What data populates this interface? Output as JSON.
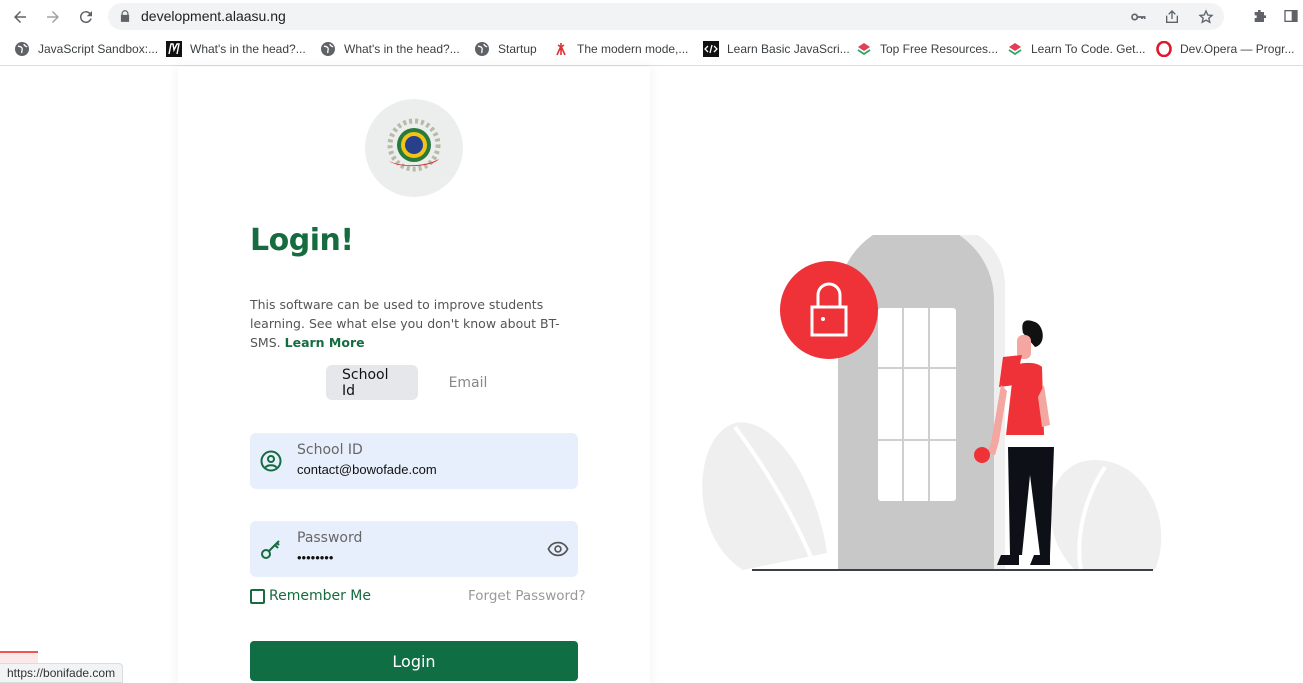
{
  "browser": {
    "url": "development.alaasu.ng",
    "status_url": "https://bonifade.com",
    "bookmarks": [
      {
        "label": "JavaScript Sandbox:...",
        "icon": "globe-icon"
      },
      {
        "label": "What's in the head?...",
        "icon": "m-logo-icon"
      },
      {
        "label": "What's in the head?...",
        "icon": "globe-icon"
      },
      {
        "label": "Startup",
        "icon": "globe-icon"
      },
      {
        "label": "The modern mode,...",
        "icon": "tower-icon"
      },
      {
        "label": "Learn Basic JavaScri...",
        "icon": "code-icon"
      },
      {
        "label": "Top Free Resources...",
        "icon": "layers-icon"
      },
      {
        "label": "Learn To Code. Get...",
        "icon": "layers-icon"
      },
      {
        "label": "Dev.Opera — Progr...",
        "icon": "opera-icon"
      }
    ]
  },
  "login": {
    "title": "Login!",
    "description": "This software can be used to improve students learning. See what else you don't know about BT-SMS.",
    "learn_more": "Learn More",
    "tabs": [
      {
        "label": "School Id",
        "active": true
      },
      {
        "label": "Email",
        "active": false
      }
    ],
    "school_id": {
      "label": "School ID",
      "value": "contact@bowofade.com"
    },
    "password": {
      "label": "Password",
      "value": "••••••••"
    },
    "remember_me": "Remember Me",
    "forgot_password": "Forget Password?",
    "login_button": "Login"
  },
  "colors": {
    "brand_green": "#166b3f",
    "button_green": "#0f6e43",
    "field_bg": "#e8effc",
    "illustration_red": "#ee3238"
  }
}
